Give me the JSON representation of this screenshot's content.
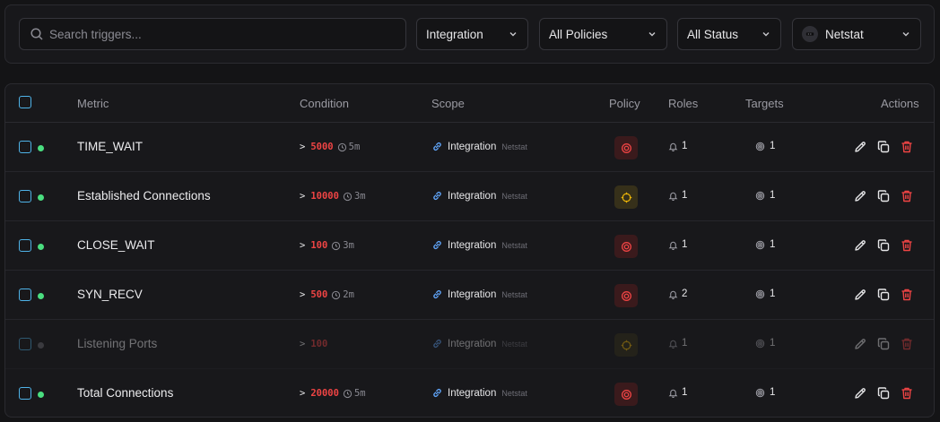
{
  "filters": {
    "search_placeholder": "Search triggers...",
    "type": "Integration",
    "policy": "All Policies",
    "status": "All Status",
    "integration": "Netstat"
  },
  "table": {
    "headers": {
      "metric": "Metric",
      "condition": "Condition",
      "scope": "Scope",
      "policy": "Policy",
      "roles": "Roles",
      "targets": "Targets",
      "actions": "Actions"
    },
    "rows": [
      {
        "metric": "TIME_WAIT",
        "op": ">",
        "threshold": "5000",
        "duration": "5m",
        "scope": "Integration",
        "scope_sub": "Netstat",
        "policy": "critical",
        "roles": "1",
        "targets": "1",
        "enabled": true
      },
      {
        "metric": "Established Connections",
        "op": ">",
        "threshold": "10000",
        "duration": "3m",
        "scope": "Integration",
        "scope_sub": "Netstat",
        "policy": "warning",
        "roles": "1",
        "targets": "1",
        "enabled": true
      },
      {
        "metric": "CLOSE_WAIT",
        "op": ">",
        "threshold": "100",
        "duration": "3m",
        "scope": "Integration",
        "scope_sub": "Netstat",
        "policy": "critical",
        "roles": "1",
        "targets": "1",
        "enabled": true
      },
      {
        "metric": "SYN_RECV",
        "op": ">",
        "threshold": "500",
        "duration": "2m",
        "scope": "Integration",
        "scope_sub": "Netstat",
        "policy": "critical",
        "roles": "2",
        "targets": "1",
        "enabled": true
      },
      {
        "metric": "Listening Ports",
        "op": ">",
        "threshold": "100",
        "duration": "",
        "scope": "Integration",
        "scope_sub": "Netstat",
        "policy": "warning",
        "roles": "1",
        "targets": "1",
        "enabled": false
      },
      {
        "metric": "Total Connections",
        "op": ">",
        "threshold": "20000",
        "duration": "5m",
        "scope": "Integration",
        "scope_sub": "Netstat",
        "policy": "critical",
        "roles": "1",
        "targets": "1",
        "enabled": true
      }
    ]
  },
  "colors": {
    "enabled_dot": "#4ade80",
    "threshold": "#ef4444",
    "critical_policy": "#ef4444",
    "warning_policy": "#eab308",
    "delete": "#ef4444",
    "checkbox": "#4fb3e8"
  }
}
